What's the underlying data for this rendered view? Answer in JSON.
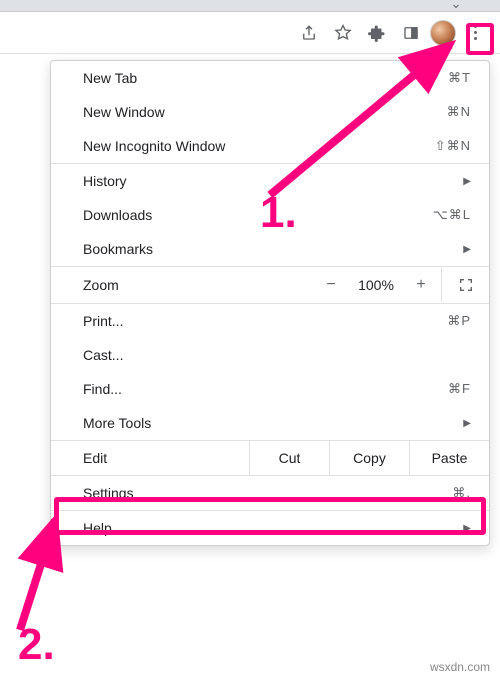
{
  "menu": {
    "new_tab": {
      "label": "New Tab",
      "shortcut": "⌘T"
    },
    "new_window": {
      "label": "New Window",
      "shortcut": "⌘N"
    },
    "new_incognito": {
      "label": "New Incognito Window",
      "shortcut": "⇧⌘N"
    },
    "history": {
      "label": "History"
    },
    "downloads": {
      "label": "Downloads",
      "shortcut": "⌥⌘L"
    },
    "bookmarks": {
      "label": "Bookmarks"
    },
    "zoom": {
      "label": "Zoom",
      "minus": "−",
      "value": "100%",
      "plus": "+"
    },
    "print": {
      "label": "Print...",
      "shortcut": "⌘P"
    },
    "cast": {
      "label": "Cast..."
    },
    "find": {
      "label": "Find...",
      "shortcut": "⌘F"
    },
    "more_tools": {
      "label": "More Tools"
    },
    "edit": {
      "label": "Edit",
      "cut": "Cut",
      "copy": "Copy",
      "paste": "Paste"
    },
    "settings": {
      "label": "Settings",
      "shortcut": "⌘,"
    },
    "help": {
      "label": "Help"
    }
  },
  "callouts": {
    "one": "1.",
    "two": "2."
  },
  "watermark": "wsxdn.com"
}
